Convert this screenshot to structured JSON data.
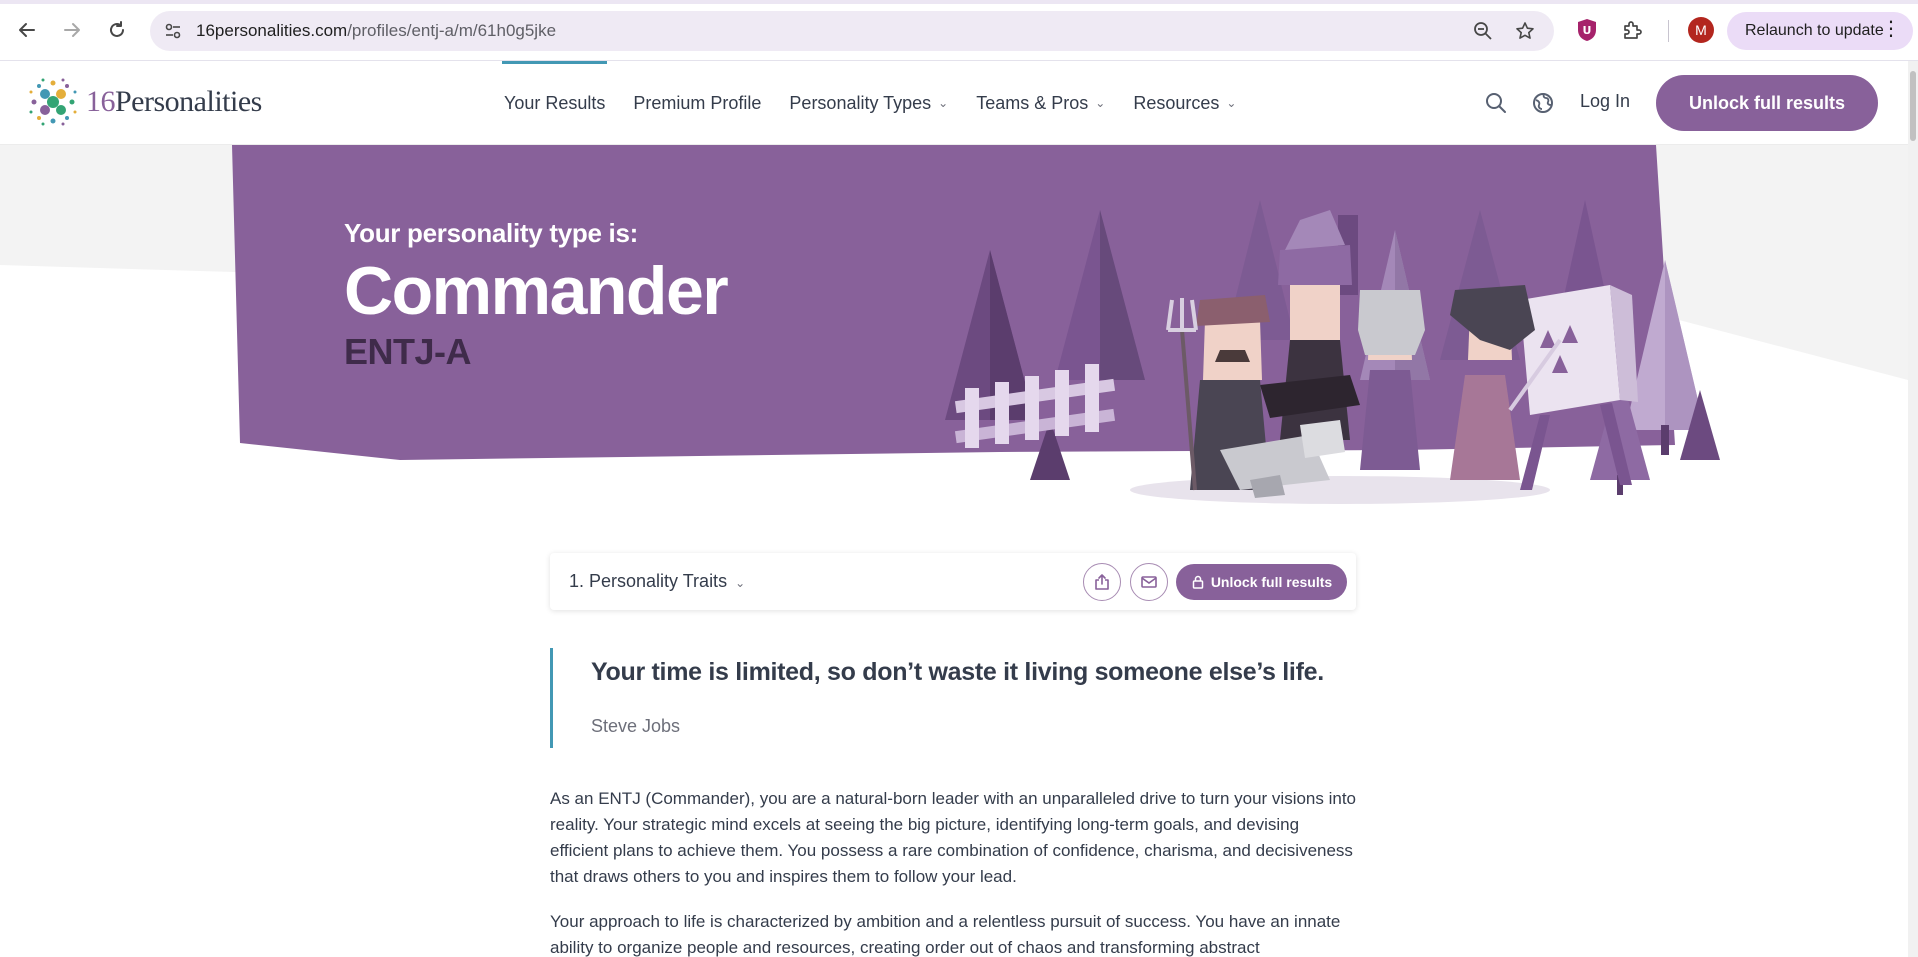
{
  "browser": {
    "url_host": "16personalities.com",
    "url_path": "/profiles/entj-a/m/61h0g5jke",
    "profile_initial": "M",
    "relaunch_label": "Relaunch to update"
  },
  "header": {
    "logo_number": "16",
    "logo_word": "Personalities",
    "nav": [
      {
        "label": "Your Results",
        "active": true,
        "dropdown": false
      },
      {
        "label": "Premium Profile",
        "active": false,
        "dropdown": false
      },
      {
        "label": "Personality Types",
        "active": false,
        "dropdown": true
      },
      {
        "label": "Teams & Pros",
        "active": false,
        "dropdown": true
      },
      {
        "label": "Resources",
        "active": false,
        "dropdown": true
      }
    ],
    "login_label": "Log In",
    "unlock_label": "Unlock full results"
  },
  "hero": {
    "label": "Your personality type is:",
    "title": "Commander",
    "code": "ENTJ-A"
  },
  "section_bar": {
    "selected_section": "1. Personality Traits",
    "unlock_label": "Unlock full results"
  },
  "quote": {
    "text": "Your time is limited, so don’t waste it living someone else’s life.",
    "author": "Steve Jobs"
  },
  "body": {
    "paragraphs": [
      "As an ENTJ (Commander), you are a natural-born leader with an unparalleled drive to turn your visions into reality. Your strategic mind excels at seeing the big picture, identifying long-term goals, and devising efficient plans to achieve them. You possess a rare combination of confidence, charisma, and decisiveness that draws others to you and inspires them to follow your lead.",
      "Your approach to life is characterized by ambition and a relentless pursuit of success. You have an innate ability to organize people and resources, creating order out of chaos and transforming abstract"
    ]
  },
  "colors": {
    "brand_purple": "#88619a",
    "hero_purple": "#88619a",
    "accent_teal": "#4298b4",
    "text_dark": "#343c4b"
  }
}
